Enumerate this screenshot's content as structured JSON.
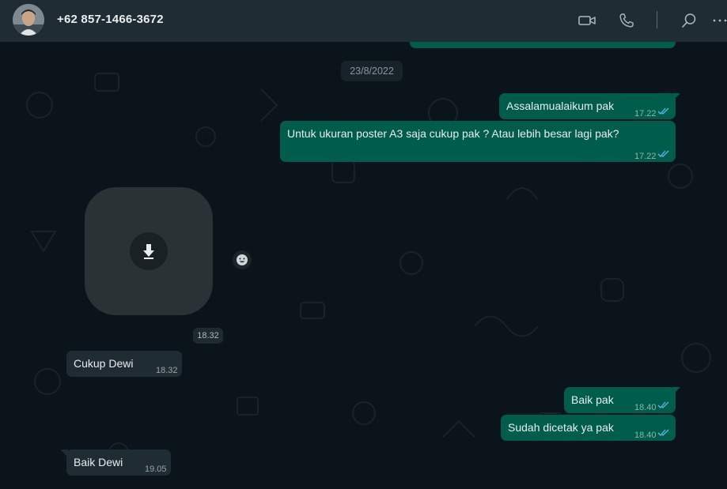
{
  "header": {
    "contact_name": "+62 857-1466-3672",
    "icons": [
      "video-call-icon",
      "voice-call-icon",
      "search-icon",
      "menu-icon"
    ]
  },
  "chat": {
    "date_label": "23/8/2022",
    "messages": [
      {
        "direction": "outgoing",
        "text": "Assalamualaikum pak",
        "time": "17.22",
        "status": "read"
      },
      {
        "direction": "outgoing",
        "text": "Untuk ukuran poster A3 saja cukup pak ? Atau lebih besar lagi pak?",
        "time": "17.22",
        "status": "read"
      },
      {
        "direction": "incoming",
        "type": "media",
        "time": "18.32"
      },
      {
        "direction": "incoming",
        "text": "Cukup Dewi",
        "time": "18.32"
      },
      {
        "direction": "outgoing",
        "text": "Baik pak",
        "time": "18.40",
        "status": "read"
      },
      {
        "direction": "outgoing",
        "text": "Sudah dicetak ya pak",
        "time": "18.40",
        "status": "read"
      },
      {
        "direction": "incoming",
        "text": "Baik Dewi",
        "time": "19.05"
      }
    ]
  },
  "colors": {
    "header_bg": "#202c33",
    "chat_bg": "#0b141a",
    "outgoing_bubble": "#005c4b",
    "incoming_bubble": "#202c33",
    "read_ticks": "#53bdeb"
  }
}
